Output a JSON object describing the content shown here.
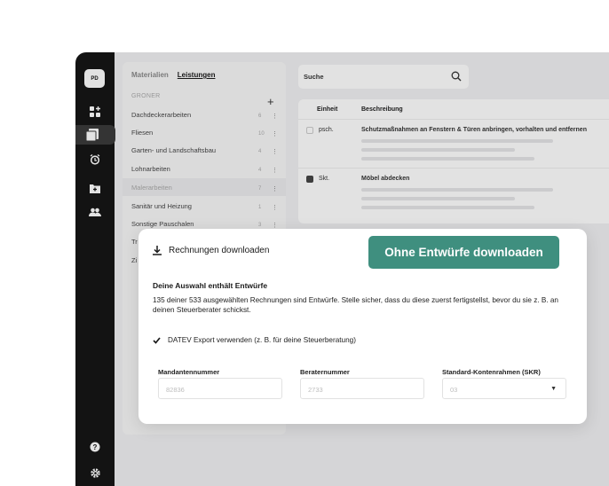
{
  "sidebar": {
    "avatar_initials": "PD",
    "nav_icons": [
      "dashboard-icon",
      "documents-icon",
      "alarm-icon",
      "folder-add-icon",
      "users-icon"
    ],
    "bottom_icons": [
      "help-icon",
      "settings-icon"
    ]
  },
  "left_panel": {
    "tabs": [
      "Materialien",
      "Leistungen"
    ],
    "add_label": "+",
    "group_label": "GRONER",
    "items": [
      {
        "name": "Dachdeckerarbeiten",
        "count": "6"
      },
      {
        "name": "Fliesen",
        "count": "10"
      },
      {
        "name": "Garten- und Landschaftsbau",
        "count": "4"
      },
      {
        "name": "Lohnarbeiten",
        "count": "4"
      },
      {
        "name": "Malerarbeiten",
        "count": "7"
      },
      {
        "name": "Sanitär und Heizung",
        "count": "1"
      },
      {
        "name": "Sonstige Pauschalen",
        "count": "3"
      },
      {
        "name": "Tr",
        "count": ""
      },
      {
        "name": "Zi",
        "count": ""
      }
    ]
  },
  "search": {
    "label": "Suche"
  },
  "table": {
    "headers": [
      "Einheit",
      "Beschreibung"
    ],
    "rows": [
      {
        "unit": "psch.",
        "description": "Schutzmaßnahmen an Fenstern & Türen anbringen, vorhalten und entfernen",
        "checked": false
      },
      {
        "unit": "Skt.",
        "description": "Möbel abdecken",
        "checked": true
      }
    ]
  },
  "modal": {
    "title": "Rechnungen downloaden",
    "cta": "Ohne Entwürfe downloaden",
    "notice_heading": "Deine Auswahl enthält Entwürfe",
    "notice_body": "135 deiner 533 ausgewählten Rechnungen sind Entwürfe. Stelle sicher, dass du diese zuerst fertigstellst, bevor du sie z. B. an deinen Steuerberater schickst.",
    "datev_label": "DATEV Export verwenden (z. B. für deine Steuerberatung)",
    "fields": [
      {
        "label": "Mandantennummer",
        "placeholder": "82836"
      },
      {
        "label": "Beraternummer",
        "placeholder": "2733"
      },
      {
        "label": "Standard-Kontenrahmen (SKR)",
        "placeholder": "03"
      }
    ]
  },
  "colors": {
    "accent": "#3f8f7f",
    "sidebar": "#141414"
  }
}
